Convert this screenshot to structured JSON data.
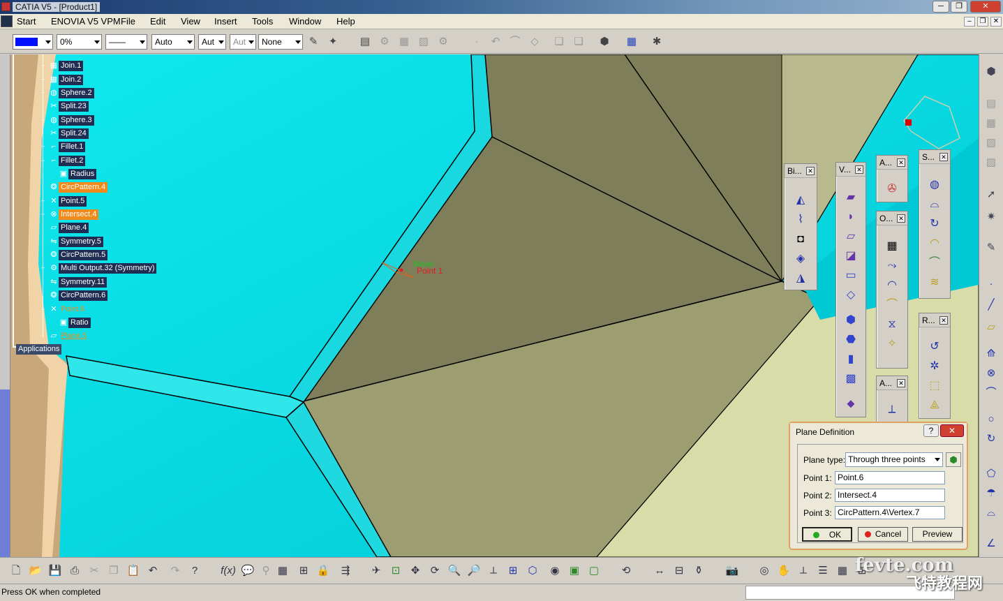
{
  "window": {
    "title": "CATIA V5 - [Product1]",
    "minimize": "─",
    "restore": "❐",
    "close": "✕"
  },
  "menu": {
    "items": [
      "Start",
      "ENOVIA V5 VPM",
      "File",
      "Edit",
      "View",
      "Insert",
      "Tools",
      "Window",
      "Help"
    ],
    "mdi": [
      "–",
      "❐",
      "✕"
    ]
  },
  "toolbar": {
    "color_value": "",
    "transparency": "0%",
    "linetype": "——",
    "thickness": "Auto",
    "layer1": "Aut",
    "layer2": "Aut",
    "layer3": "None",
    "accent": "#0010ff"
  },
  "tree": {
    "nodes": [
      {
        "label": "Join.1",
        "state": "normal"
      },
      {
        "label": "Join.2",
        "state": "normal"
      },
      {
        "label": "Sphere.2",
        "state": "normal"
      },
      {
        "label": "Split.23",
        "state": "normal"
      },
      {
        "label": "Sphere.3",
        "state": "normal"
      },
      {
        "label": "Split.24",
        "state": "normal"
      },
      {
        "label": "Fillet.1",
        "state": "normal"
      },
      {
        "label": "Fillet.2",
        "state": "normal"
      },
      {
        "label": "Radius",
        "state": "normal"
      },
      {
        "label": "CircPattern.4",
        "state": "highlighted"
      },
      {
        "label": "Point.5",
        "state": "normal"
      },
      {
        "label": "Intersect.4",
        "state": "highlighted"
      },
      {
        "label": "Plane.4",
        "state": "normal"
      },
      {
        "label": "Symmetry.5",
        "state": "normal"
      },
      {
        "label": "CircPattern.5",
        "state": "normal"
      },
      {
        "label": "Multi Output.32 (Symmetry)",
        "state": "normal"
      },
      {
        "label": "Symmetry.11",
        "state": "normal"
      },
      {
        "label": "CircPattern.6",
        "state": "normal"
      },
      {
        "label": "Point.6",
        "state": "highlighted-text"
      },
      {
        "label": "Ratio",
        "state": "normal"
      },
      {
        "label": "Plane.5",
        "state": "highlighted-text"
      }
    ],
    "applications": "Applications"
  },
  "viewport": {
    "move_label": "Move",
    "point_label": "Point 1"
  },
  "panels": {
    "bi": "Bi...",
    "v": "V...",
    "a1": "A...",
    "s": "S...",
    "o": "O...",
    "r": "R...",
    "a2": "A..."
  },
  "dialog": {
    "title": "Plane Definition",
    "help": "?",
    "close": "✕",
    "plane_type_label": "Plane type:",
    "plane_type_value": "Through three points",
    "point1_label": "Point 1:",
    "point1_value": "Point.6",
    "point2_label": "Point 2:",
    "point2_value": "Intersect.4",
    "point3_label": "Point 3:",
    "point3_value": "CircPattern.4\\Vertex.7",
    "ok": "OK",
    "cancel": "Cancel",
    "preview": "Preview"
  },
  "status": {
    "message": "Press OK when completed"
  },
  "watermark": {
    "line1": "fevte.com",
    "line2": "飞特教程网"
  }
}
